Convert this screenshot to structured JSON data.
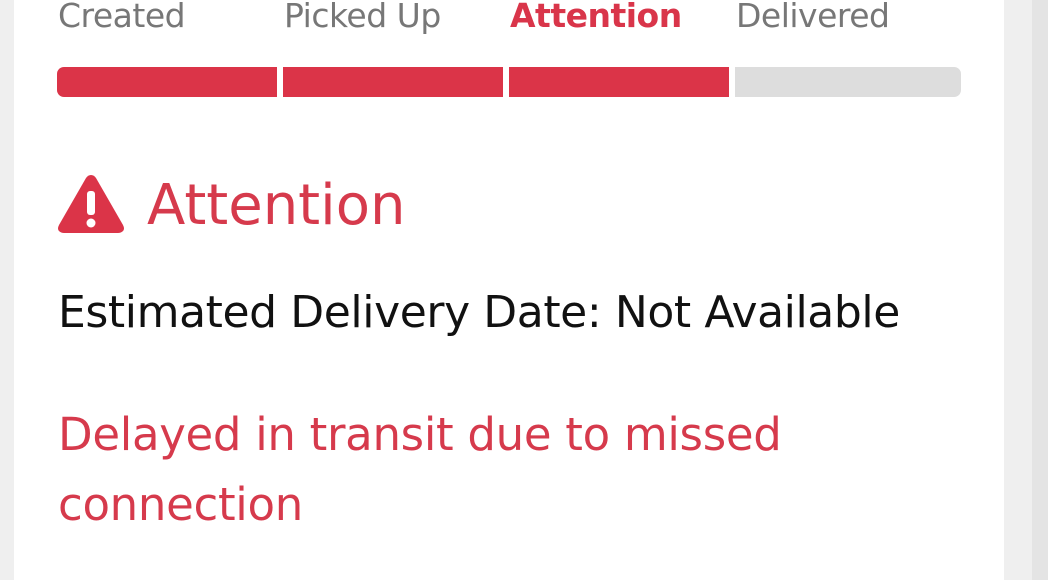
{
  "tracker": {
    "steps": [
      {
        "label": "Created",
        "state": "complete"
      },
      {
        "label": "Picked Up",
        "state": "complete"
      },
      {
        "label": "Attention",
        "state": "current"
      },
      {
        "label": "Delivered",
        "state": "pending"
      }
    ],
    "progress_completed_steps": 3,
    "progress_total_steps": 4
  },
  "status": {
    "icon": "warning-triangle-icon",
    "title": "Attention",
    "estimated_delivery": "Estimated Delivery Date: Not Available",
    "message": "Delayed in transit due to missed connection"
  },
  "colors": {
    "accent": "#db3448",
    "pending": "#dddddd",
    "muted_text": "#777777",
    "body_text": "#111111"
  }
}
